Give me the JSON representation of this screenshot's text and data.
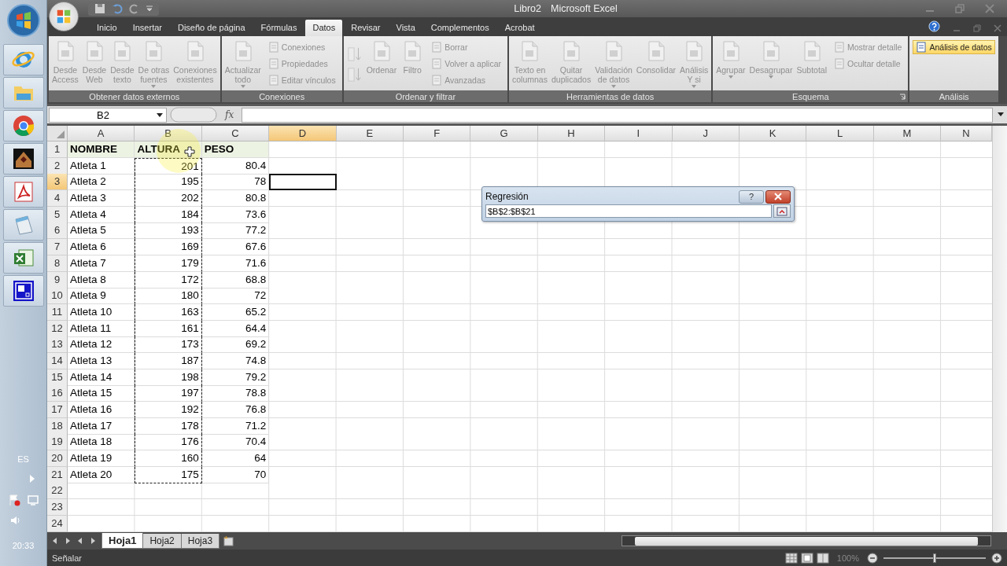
{
  "taskbar": {
    "language": "ES",
    "clock": "20:33"
  },
  "window": {
    "document": "Libro2",
    "app": "Microsoft Excel"
  },
  "tabs": [
    {
      "label": "Inicio",
      "selected": false
    },
    {
      "label": "Insertar",
      "selected": false
    },
    {
      "label": "Diseño de página",
      "selected": false
    },
    {
      "label": "Fórmulas",
      "selected": false
    },
    {
      "label": "Datos",
      "selected": true
    },
    {
      "label": "Revisar",
      "selected": false
    },
    {
      "label": "Vista",
      "selected": false
    },
    {
      "label": "Complementos",
      "selected": false
    },
    {
      "label": "Acrobat",
      "selected": false
    }
  ],
  "ribbon": {
    "groups": [
      {
        "label": "Obtener datos externos",
        "launcher": false,
        "items": [
          {
            "kind": "large",
            "label": "Desde\nAccess",
            "dropdown": false,
            "disabled": true
          },
          {
            "kind": "large",
            "label": "Desde\nWeb",
            "dropdown": false,
            "disabled": true
          },
          {
            "kind": "large",
            "label": "Desde\ntexto",
            "dropdown": false,
            "disabled": true
          },
          {
            "kind": "large",
            "label": "De otras\nfuentes",
            "dropdown": true,
            "disabled": true
          },
          {
            "kind": "large",
            "label": "Conexiones\nexistentes",
            "dropdown": false,
            "disabled": true
          }
        ]
      },
      {
        "label": "Conexiones",
        "launcher": false,
        "items": [
          {
            "kind": "large",
            "label": "Actualizar\ntodo",
            "dropdown": true,
            "disabled": true
          },
          {
            "kind": "small",
            "label": "Conexiones",
            "disabled": true,
            "highlighted": false
          },
          {
            "kind": "small",
            "label": "Propiedades",
            "disabled": true,
            "highlighted": false
          },
          {
            "kind": "small",
            "label": "Editar vínculos",
            "disabled": true,
            "highlighted": false
          }
        ]
      },
      {
        "label": "Ordenar y filtrar",
        "launcher": false,
        "items": [
          {
            "kind": "sort",
            "disabled": true
          },
          {
            "kind": "large",
            "label": "Ordenar",
            "dropdown": false,
            "disabled": true
          },
          {
            "kind": "large",
            "label": "Filtro",
            "dropdown": false,
            "disabled": true
          },
          {
            "kind": "small",
            "label": "Borrar",
            "disabled": true,
            "highlighted": false
          },
          {
            "kind": "small",
            "label": "Volver a aplicar",
            "disabled": true,
            "highlighted": false
          },
          {
            "kind": "small",
            "label": "Avanzadas",
            "disabled": true,
            "highlighted": false
          }
        ]
      },
      {
        "label": "Herramientas de datos",
        "launcher": false,
        "items": [
          {
            "kind": "large",
            "label": "Texto en\ncolumnas",
            "dropdown": false,
            "disabled": true
          },
          {
            "kind": "large",
            "label": "Quitar\nduplicados",
            "dropdown": false,
            "disabled": true
          },
          {
            "kind": "large",
            "label": "Validación\nde datos",
            "dropdown": true,
            "disabled": true
          },
          {
            "kind": "large",
            "label": "Consolidar",
            "dropdown": false,
            "disabled": true
          },
          {
            "kind": "large",
            "label": "Análisis\nY si",
            "dropdown": true,
            "disabled": true
          }
        ]
      },
      {
        "label": "Esquema",
        "launcher": true,
        "items": [
          {
            "kind": "large",
            "label": "Agrupar",
            "dropdown": true,
            "disabled": true
          },
          {
            "kind": "large",
            "label": "Desagrupar",
            "dropdown": true,
            "disabled": true
          },
          {
            "kind": "large",
            "label": "Subtotal",
            "dropdown": false,
            "disabled": true
          },
          {
            "kind": "small",
            "label": "Mostrar detalle",
            "disabled": true,
            "highlighted": false
          },
          {
            "kind": "small",
            "label": "Ocultar detalle",
            "disabled": true,
            "highlighted": false
          }
        ]
      },
      {
        "label": "Análisis",
        "launcher": false,
        "items": [
          {
            "kind": "small",
            "label": "Análisis de datos",
            "disabled": false,
            "highlighted": true
          }
        ]
      }
    ]
  },
  "formula_bar": {
    "name_box": "B2",
    "function_label": "fx"
  },
  "sheet": {
    "columns": [
      {
        "label": "A",
        "selected": false,
        "marquee": false
      },
      {
        "label": "B",
        "selected": false,
        "marquee": true
      },
      {
        "label": "C",
        "selected": false,
        "marquee": false
      },
      {
        "label": "D",
        "selected": true,
        "marquee": false
      },
      {
        "label": "E",
        "selected": false,
        "marquee": false
      },
      {
        "label": "F",
        "selected": false,
        "marquee": false
      },
      {
        "label": "G",
        "selected": false,
        "marquee": false
      },
      {
        "label": "H",
        "selected": false,
        "marquee": false
      },
      {
        "label": "I",
        "selected": false,
        "marquee": false
      },
      {
        "label": "J",
        "selected": false,
        "marquee": false
      },
      {
        "label": "K",
        "selected": false,
        "marquee": false
      },
      {
        "label": "L",
        "selected": false,
        "marquee": false
      },
      {
        "label": "M",
        "selected": false,
        "marquee": false
      },
      {
        "label": "N",
        "selected": false,
        "marquee": false
      }
    ],
    "rows": [
      {
        "number": "1",
        "kind": "header",
        "selected": false,
        "marquee": false,
        "cells": [
          "NOMBRE",
          "ALTURA",
          "PESO"
        ]
      },
      {
        "number": "2",
        "kind": "data",
        "selected": false,
        "marquee": true,
        "cells": [
          "Atleta 1",
          "201",
          "80.4"
        ]
      },
      {
        "number": "3",
        "kind": "data",
        "selected": true,
        "marquee": true,
        "cells": [
          "Atleta 2",
          "195",
          "78"
        ]
      },
      {
        "number": "4",
        "kind": "data",
        "selected": false,
        "marquee": true,
        "cells": [
          "Atleta 3",
          "202",
          "80.8"
        ]
      },
      {
        "number": "5",
        "kind": "data",
        "selected": false,
        "marquee": true,
        "cells": [
          "Atleta 4",
          "184",
          "73.6"
        ]
      },
      {
        "number": "6",
        "kind": "data",
        "selected": false,
        "marquee": true,
        "cells": [
          "Atleta 5",
          "193",
          "77.2"
        ]
      },
      {
        "number": "7",
        "kind": "data",
        "selected": false,
        "marquee": true,
        "cells": [
          "Atleta 6",
          "169",
          "67.6"
        ]
      },
      {
        "number": "8",
        "kind": "data",
        "selected": false,
        "marquee": true,
        "cells": [
          "Atleta 7",
          "179",
          "71.6"
        ]
      },
      {
        "number": "9",
        "kind": "data",
        "selected": false,
        "marquee": true,
        "cells": [
          "Atleta 8",
          "172",
          "68.8"
        ]
      },
      {
        "number": "10",
        "kind": "data",
        "selected": false,
        "marquee": true,
        "cells": [
          "Atleta 9",
          "180",
          "72"
        ]
      },
      {
        "number": "11",
        "kind": "data",
        "selected": false,
        "marquee": true,
        "cells": [
          "Atleta 10",
          "163",
          "65.2"
        ]
      },
      {
        "number": "12",
        "kind": "data",
        "selected": false,
        "marquee": true,
        "cells": [
          "Atleta 11",
          "161",
          "64.4"
        ]
      },
      {
        "number": "13",
        "kind": "data",
        "selected": false,
        "marquee": true,
        "cells": [
          "Atleta 12",
          "173",
          "69.2"
        ]
      },
      {
        "number": "14",
        "kind": "data",
        "selected": false,
        "marquee": true,
        "cells": [
          "Atleta 13",
          "187",
          "74.8"
        ]
      },
      {
        "number": "15",
        "kind": "data",
        "selected": false,
        "marquee": true,
        "cells": [
          "Atleta 14",
          "198",
          "79.2"
        ]
      },
      {
        "number": "16",
        "kind": "data",
        "selected": false,
        "marquee": true,
        "cells": [
          "Atleta 15",
          "197",
          "78.8"
        ]
      },
      {
        "number": "17",
        "kind": "data",
        "selected": false,
        "marquee": true,
        "cells": [
          "Atleta 16",
          "192",
          "76.8"
        ]
      },
      {
        "number": "18",
        "kind": "data",
        "selected": false,
        "marquee": true,
        "cells": [
          "Atleta 17",
          "178",
          "71.2"
        ]
      },
      {
        "number": "19",
        "kind": "data",
        "selected": false,
        "marquee": true,
        "cells": [
          "Atleta 18",
          "176",
          "70.4"
        ]
      },
      {
        "number": "20",
        "kind": "data",
        "selected": false,
        "marquee": true,
        "cells": [
          "Atleta 19",
          "160",
          "64"
        ]
      },
      {
        "number": "21",
        "kind": "data",
        "selected": false,
        "marquee": true,
        "cells": [
          "Atleta 20",
          "175",
          "70"
        ]
      },
      {
        "number": "22",
        "kind": "data",
        "selected": false,
        "marquee": false
      },
      {
        "number": "23",
        "kind": "data",
        "selected": false,
        "marquee": false
      },
      {
        "number": "24",
        "kind": "data",
        "selected": false,
        "marquee": false
      }
    ]
  },
  "dialog": {
    "title": "Regresión",
    "help": "?",
    "range": "$B$2:$B$21"
  },
  "sheet_tabs": [
    {
      "label": "Hoja1",
      "selected": true
    },
    {
      "label": "Hoja2",
      "selected": false
    },
    {
      "label": "Hoja3",
      "selected": false
    }
  ],
  "status_bar": {
    "mode": "Señalar",
    "zoom": "100%",
    "zoom_slider": {
      "level": 0.5
    }
  }
}
